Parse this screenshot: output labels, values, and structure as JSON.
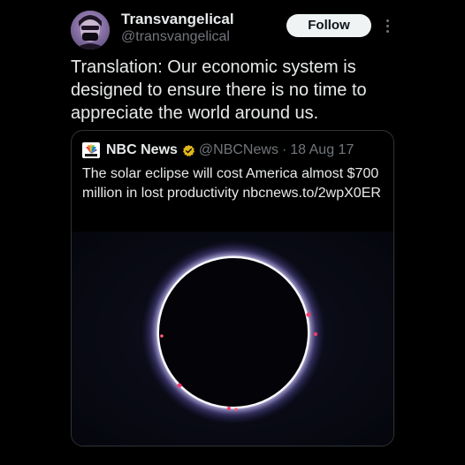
{
  "author": {
    "name": "Transvangelical",
    "handle": "@transvangelical",
    "avatar_icon": "masked-avatar-icon"
  },
  "actions": {
    "follow_label": "Follow",
    "more_icon": "more-dots-vertical-icon"
  },
  "tweet": {
    "text": "Translation: Our economic system is designed to ensure there is no time to appreciate the world around us."
  },
  "quoted": {
    "name": "NBC News",
    "handle": "@NBCNews",
    "separator": "·",
    "date": "18 Aug 17",
    "text": "The solar eclipse will cost America almost $700 million in lost productivity nbcnews.to/2wpX0ER",
    "logo_icon": "nbc-peacock-icon",
    "badge_icon": "verified-badge-icon",
    "media_icon": "solar-eclipse-image"
  },
  "colors": {
    "background": "#000000",
    "text": "#e7e9ea",
    "secondary_text": "#71767b",
    "border": "#2f3336",
    "verified_gold": "#e2b719",
    "follow_bg": "#eff3f4"
  }
}
